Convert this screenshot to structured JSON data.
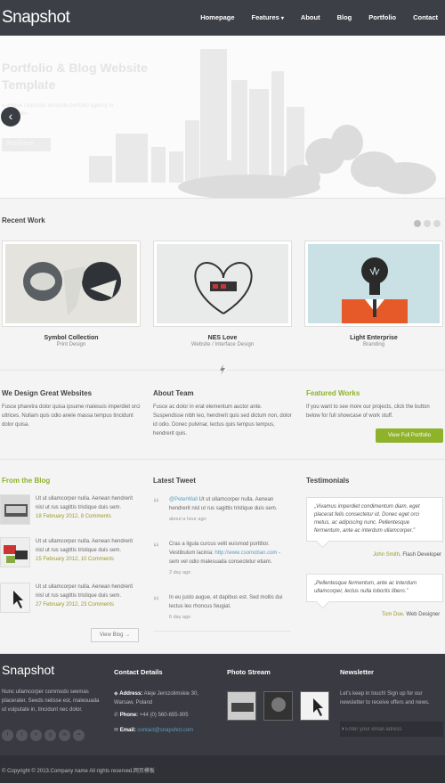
{
  "header": {
    "logo": "Snapshot",
    "nav": [
      "Homepage",
      "Features",
      "About",
      "Blog",
      "Portfolio",
      "Contact"
    ]
  },
  "hero": {
    "title": "Portfolio & Blog Website Template",
    "text": "a unique corporate template portfolio agency or companies",
    "button": "Purchase",
    "prev_arrow": "‹"
  },
  "recent_work": {
    "title": "Recent Work",
    "items": [
      {
        "name": "Symbol Collection",
        "category": "Print Design"
      },
      {
        "name": "NES Love",
        "category": "Website / Interface Design"
      },
      {
        "name": "Light Enterprise",
        "category": "Branding"
      }
    ]
  },
  "columns": {
    "design": {
      "title": "We Design Great Websites",
      "text": "Fusce pharetra dolor quisa ipsume malesuis imperdiet orci ultrices. Nullam quis odio anele massa tempus tincidunt dolor quisa."
    },
    "about": {
      "title": "About Team",
      "text": "Fusce ac dolor in erat elementum auctor ante. Suspendisse nibh leo, hendrerit quis sed dictum non, dolor id odio. Donec pulvinar, lectus quis tempus tempus, hendrerit quis."
    },
    "featured": {
      "title": "Featured Works",
      "text": "If you want to see more our projects, click the button below for full showcase of work stuff.",
      "button": "View Full Portfolio"
    }
  },
  "blog": {
    "title": "From the Blog",
    "posts": [
      {
        "text": "Ut ut ullamcorper nulla. Aenean hendrerit nisl ut rus sagittis tristique duis sem.",
        "date": "18 February 2012,",
        "comments": "8 Comments"
      },
      {
        "text": "Ut ut ullamcorper nulla. Aenean hendrerit nisl ut rus sagittis tristique duis sem.",
        "date": "15 February 2012,",
        "comments": "10 Comments"
      },
      {
        "text": "Ut ut ullamcorper nulla. Aenean hendrerit nisl ut rus sagittis tristique duis sem.",
        "date": "27 February 2012,",
        "comments": "23 Comments"
      }
    ],
    "view_blog": "View Blog →"
  },
  "tweets": {
    "title": "Latest Tweet",
    "items": [
      {
        "handle": "@PeterWall",
        "text": " Ut ut ullamcorper nulla. Aenean hendrerit nisl ut rus sagittis tristique duis sem.",
        "ago": "about a hour ago"
      },
      {
        "text": "Cras a ligula curcus velit euismod porttitor. Vestibulum lacinia: ",
        "link": "http://www.csomoban.com",
        "text2": " - sem vel odio malesuada consectetur etiam.",
        "ago": "2 day ago"
      },
      {
        "text": "In eu justo augue, et dapibus est. Sed mollis dui lectus leo rhoncus feugiat.",
        "ago": "6 day ago"
      }
    ]
  },
  "testimonials": {
    "title": "Testimonials",
    "items": [
      {
        "quote": "„Vivamus imperdiet condimentum diam, eget placerat felis consectetur id. Donec eget orci metus, ac adipiscing nunc. Pellentesque fermentum, ante ac interdum ullamcorper.”",
        "name": "John Smith,",
        "role": " Flash Developer"
      },
      {
        "quote": "„Pellentesque fermentum, ante ac interdum ullamcorper, lectus nulla lobortis libero.”",
        "name": "Tom Doe,",
        "role": " Web Designer"
      }
    ]
  },
  "footer": {
    "logo": "Snapshot",
    "about_text": "Nunc ullamcorper commodo seemas placerater. Seeds nelisse est, malesuada ut vulputate in, tincidunt nec dolor.",
    "contact_title": "Contact Details",
    "address_label": "Address:",
    "address": "Aleje Jerozolimskie 30, Warsaw, Poland",
    "phone_label": "Phone:",
    "phone": "+44 (0) 560-655-905",
    "email_label": "Email:",
    "email": "contact@snapshot.com",
    "photo_title": "Photo Stream",
    "newsletter_title": "Newsletter",
    "newsletter_text": "Let's keep in touch! Sign up for our newsletter to receive offers and news.",
    "email_placeholder": "Enter your email adress",
    "socials": [
      "f",
      "t",
      "v",
      "g",
      "in",
      "••"
    ],
    "copyright": "© Copyright © 2013.Company name All rights reserved.网页模板"
  }
}
